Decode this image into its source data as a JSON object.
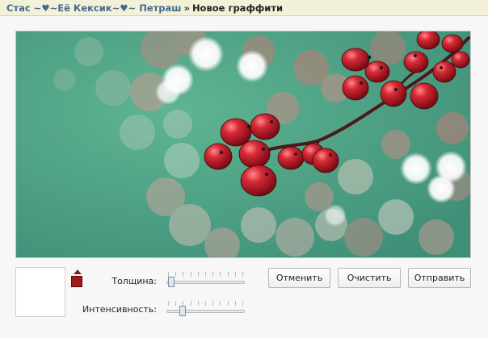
{
  "breadcrumb": {
    "user_link": "Стас ~♥~Её Кексик~♥~ Петраш",
    "separator": "»",
    "current": "Новое граффити"
  },
  "canvas": {
    "image": "red-berries-branch-bokeh",
    "background_color": "#4a9e82"
  },
  "brush": {
    "color": "#a01818"
  },
  "controls": {
    "thickness_label": "Толщина:",
    "thickness_value": 0.02,
    "intensity_label": "Интенсивность:",
    "intensity_value": 0.18
  },
  "buttons": {
    "cancel": "Отменить",
    "clear": "Очистить",
    "send": "Отправить"
  },
  "icons": {
    "color_picker_arrow": "triangle-up-icon"
  }
}
